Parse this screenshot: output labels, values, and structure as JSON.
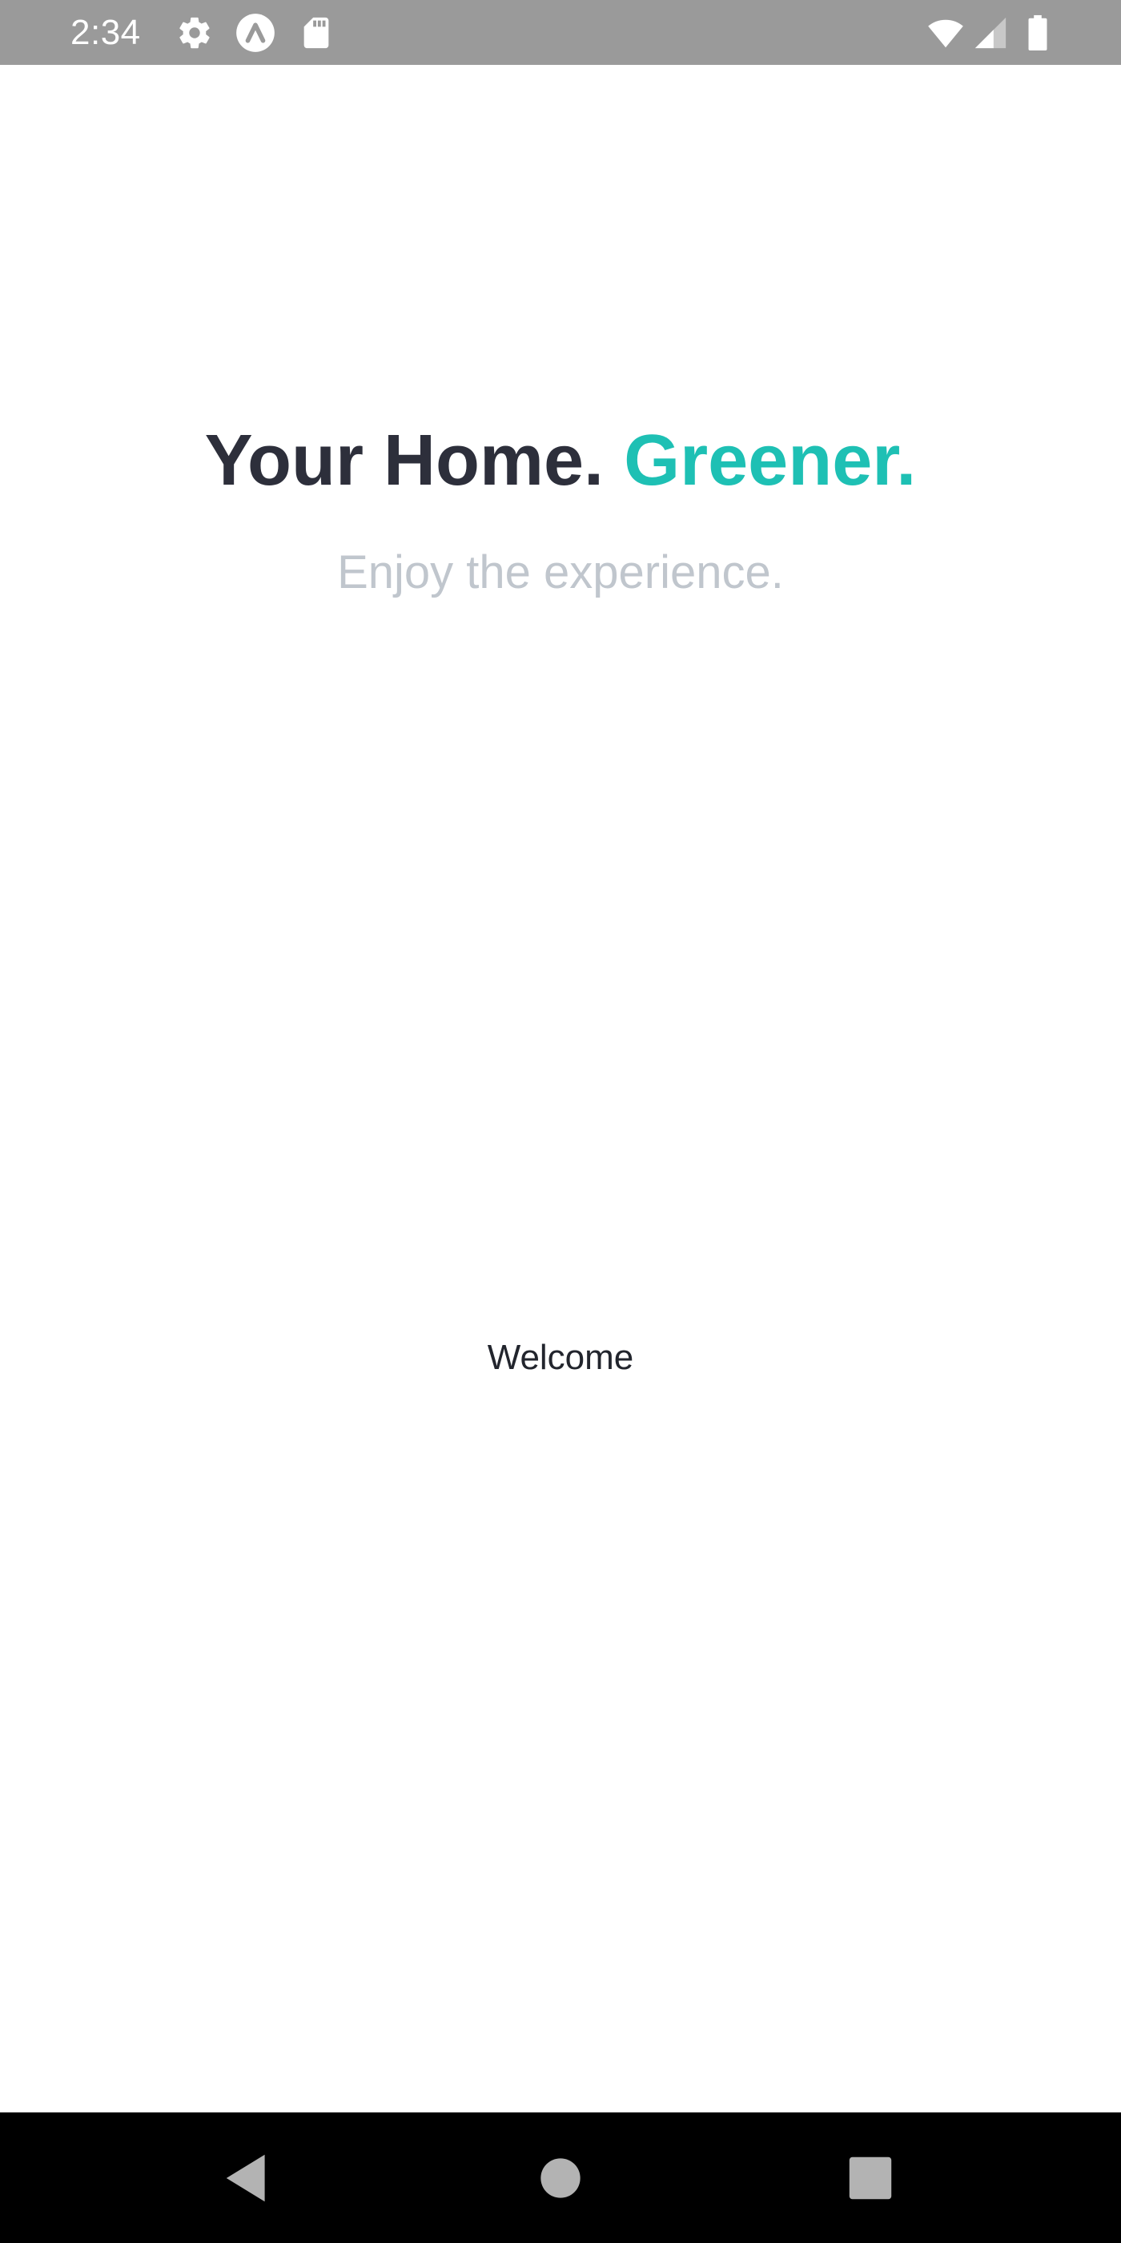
{
  "status_bar": {
    "time": "2:34",
    "left_icons": [
      "gear-icon",
      "app-logo-icon",
      "sd-card-icon"
    ],
    "right_icons": [
      "wifi-icon",
      "cell-signal-icon",
      "battery-icon"
    ],
    "background_color": "#9a9a9a"
  },
  "hero": {
    "title_main": "Your Home.",
    "title_accent": "Greener.",
    "subtitle": "Enjoy the experience.",
    "title_color": "#2d2f3b",
    "accent_color": "#1ec0b4",
    "subtitle_color": "#c0c6cd"
  },
  "main": {
    "welcome_text": "Welcome"
  },
  "nav_bar": {
    "buttons": [
      "back-icon",
      "home-icon",
      "recents-icon"
    ]
  }
}
